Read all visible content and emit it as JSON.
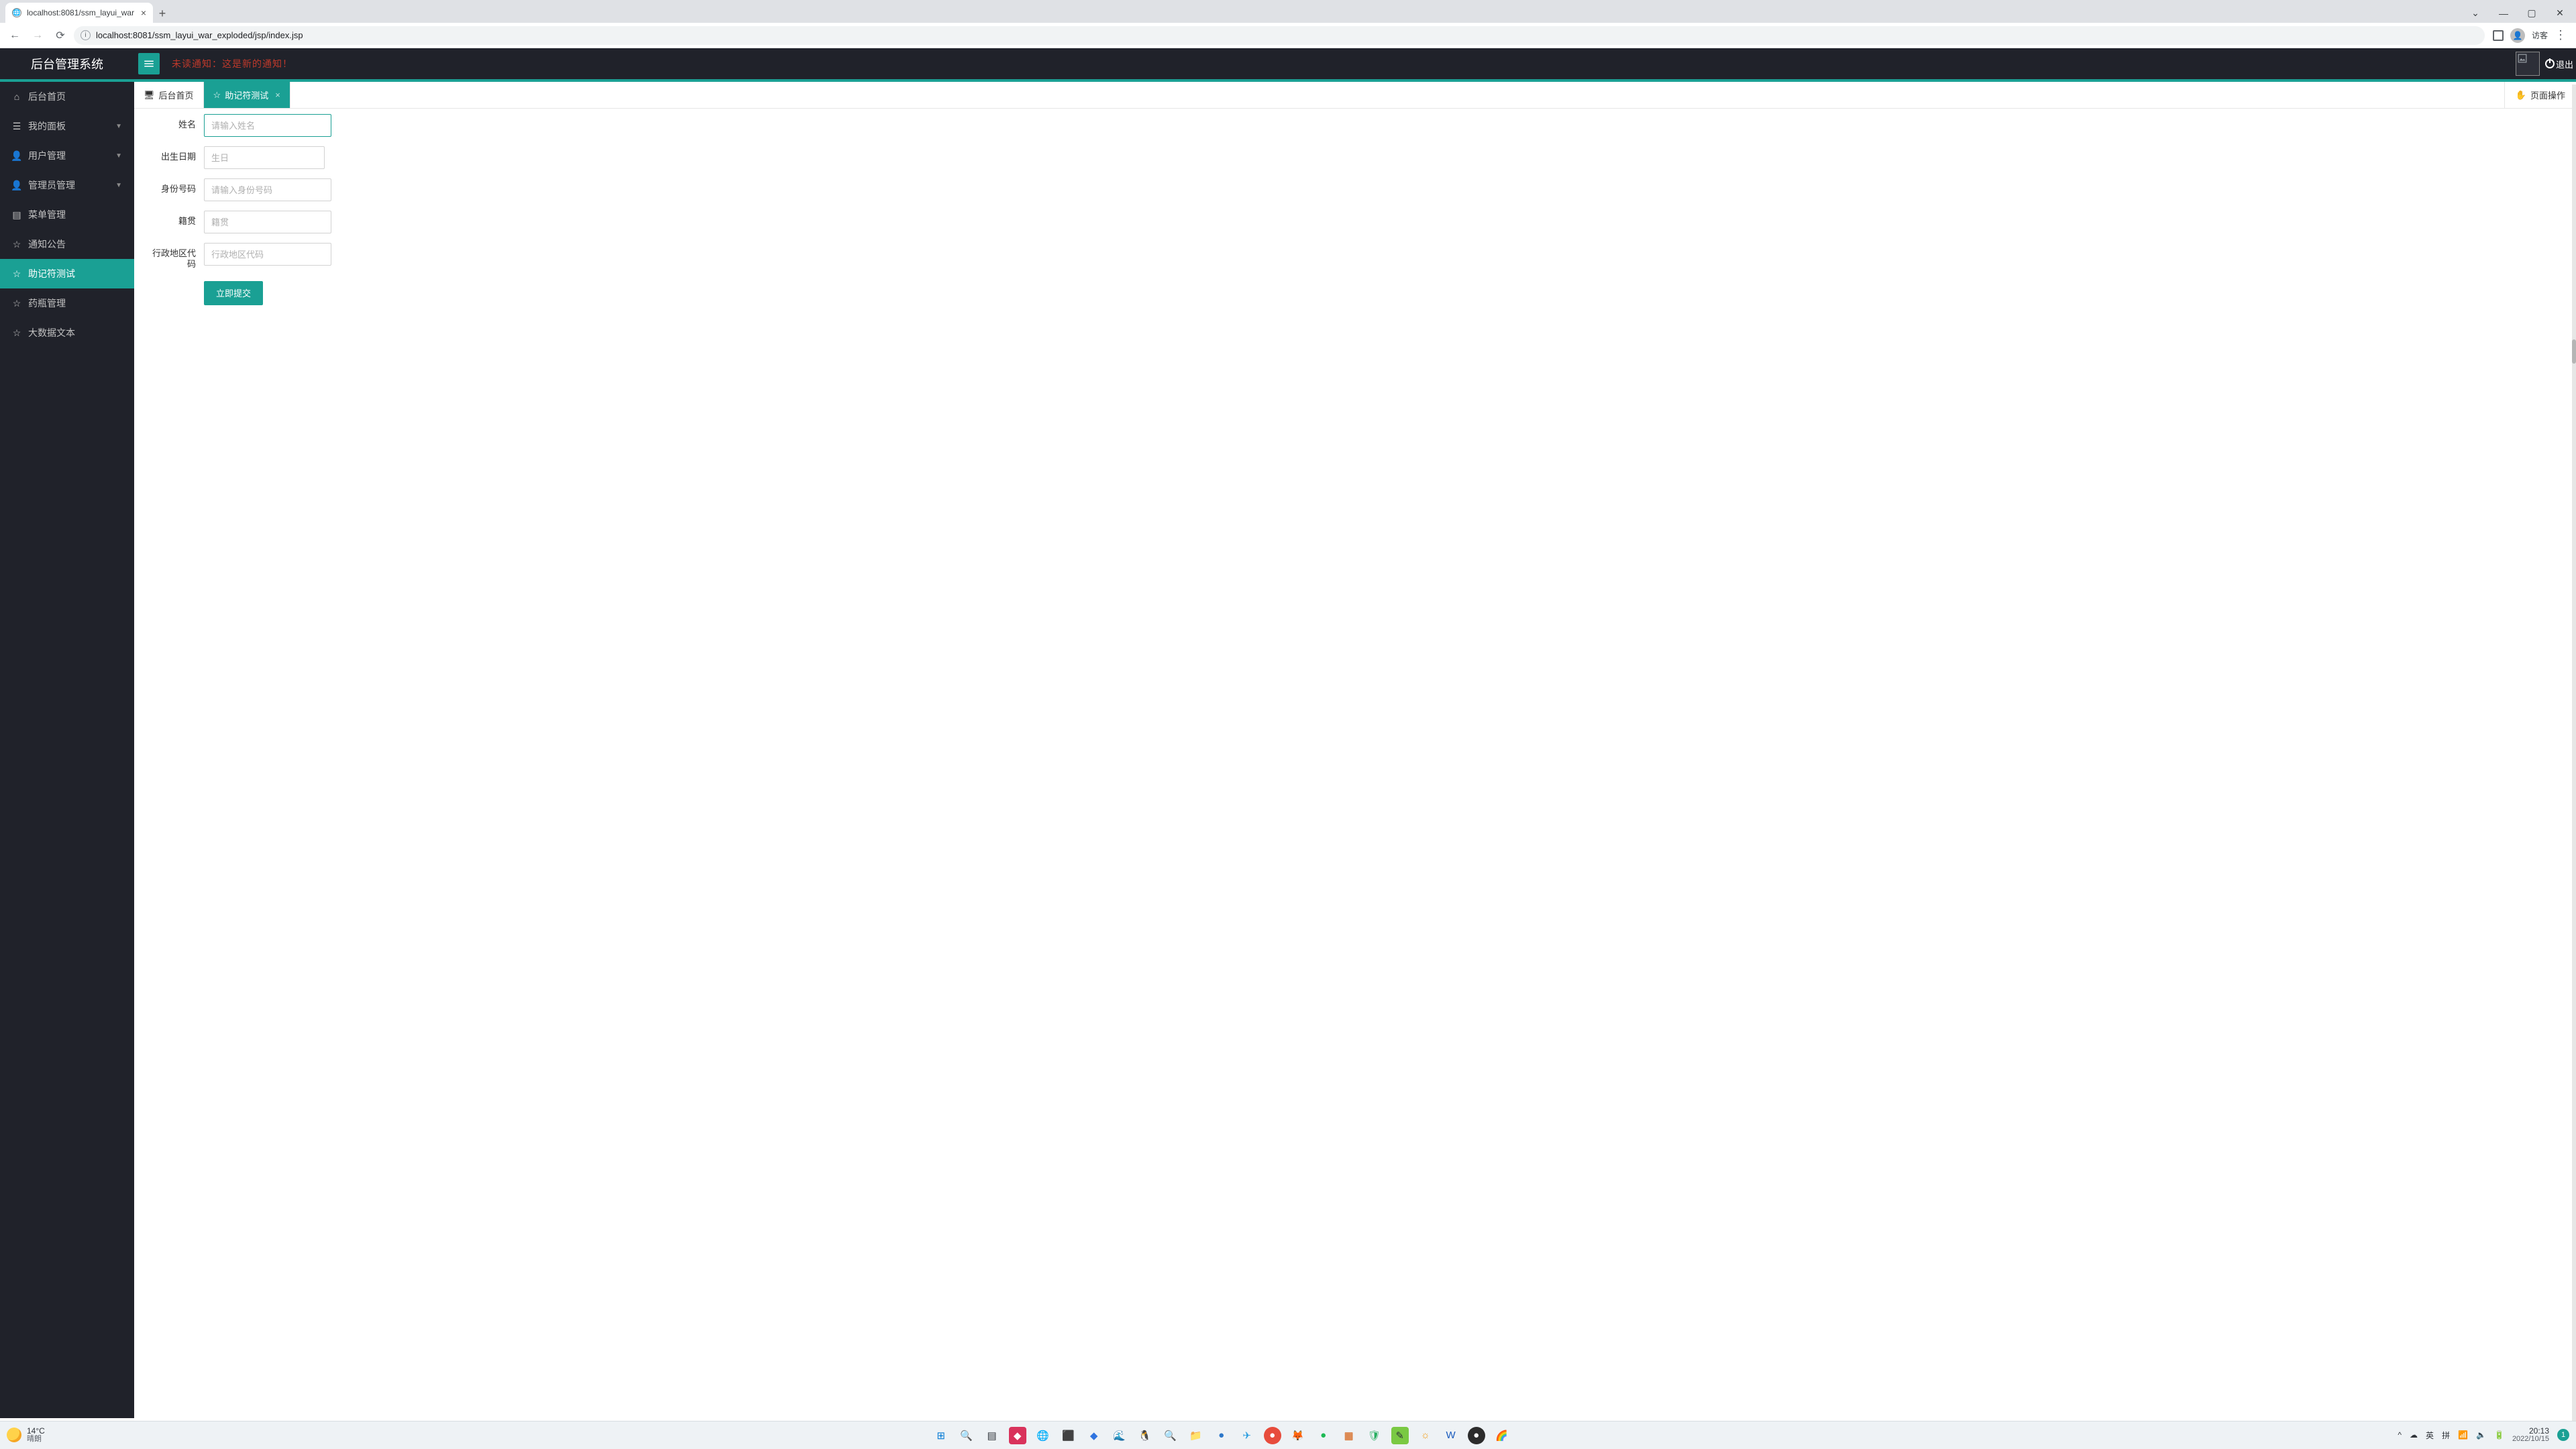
{
  "browser": {
    "tab_title": "localhost:8081/ssm_layui_war",
    "url": "localhost:8081/ssm_layui_war_exploded/jsp/index.jsp",
    "guest_label": "访客"
  },
  "header": {
    "app_title": "后台管理系统",
    "marquee": "未读通知：这是新的通知！",
    "logout_label": "退出"
  },
  "sidebar": {
    "items": [
      {
        "label": "后台首页",
        "icon": "home",
        "has_children": false,
        "active": false
      },
      {
        "label": "我的面板",
        "icon": "user",
        "has_children": true,
        "active": false
      },
      {
        "label": "用户管理",
        "icon": "person",
        "has_children": true,
        "active": false
      },
      {
        "label": "管理员管理",
        "icon": "person",
        "has_children": true,
        "active": false
      },
      {
        "label": "菜单管理",
        "icon": "list",
        "has_children": false,
        "active": false
      },
      {
        "label": "通知公告",
        "icon": "star",
        "has_children": false,
        "active": false
      },
      {
        "label": "助记符测试",
        "icon": "star",
        "has_children": false,
        "active": true
      },
      {
        "label": "药瓶管理",
        "icon": "star",
        "has_children": false,
        "active": false
      },
      {
        "label": "大数据文本",
        "icon": "star",
        "has_children": false,
        "active": false
      }
    ]
  },
  "tabs": {
    "items": [
      {
        "label": "后台首页",
        "icon": "monitor",
        "active": false,
        "closable": false
      },
      {
        "label": "助记符测试",
        "icon": "star",
        "active": true,
        "closable": true
      }
    ],
    "page_ops_label": "页面操作"
  },
  "form": {
    "fields": [
      {
        "label": "姓名",
        "placeholder": "请输入姓名",
        "value": "",
        "width": "normal",
        "focused": true
      },
      {
        "label": "出生日期",
        "placeholder": "生日",
        "value": "",
        "width": "narrow",
        "focused": false
      },
      {
        "label": "身份号码",
        "placeholder": "请输入身份号码",
        "value": "",
        "width": "normal",
        "focused": false
      },
      {
        "label": "籍贯",
        "placeholder": "籍贯",
        "value": "",
        "width": "normal",
        "focused": false
      },
      {
        "label": "行政地区代码",
        "placeholder": "行政地区代码",
        "value": "",
        "width": "normal",
        "focused": false
      }
    ],
    "submit_label": "立即提交"
  },
  "taskbar": {
    "weather_temp": "14°C",
    "weather_desc": "晴朗",
    "ime_lang": "英",
    "ime_method": "拼",
    "time": "20:13",
    "date": "2022/10/15",
    "notif_count": "1"
  }
}
